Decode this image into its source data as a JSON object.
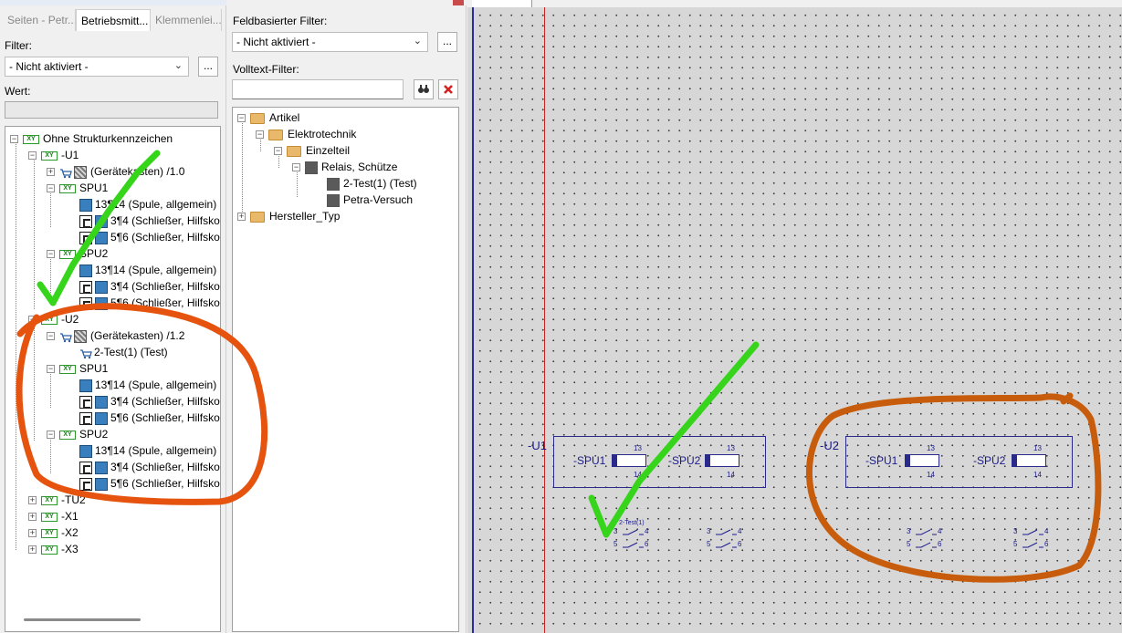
{
  "left_panel": {
    "tabs": [
      "Seiten - Petr...",
      "Betriebsmitt...",
      "Klemmenlei..."
    ],
    "filter_label": "Filter:",
    "filter_value": "- Nicht aktiviert -",
    "filter_button": "...",
    "value_label": "Wert:",
    "tree": {
      "root": "Ohne Strukturkennzeichen",
      "u1": "-U1",
      "u1_box": "(Gerätekasten) /1.0",
      "u1_spu1": "SPU1",
      "u1_spu1_coil": "13¶14 (Spule, allgemein)",
      "u1_spu1_c34": "3¶4 (Schließer, Hilfsko",
      "u1_spu1_c56": "5¶6 (Schließer, Hilfsko",
      "u1_spu2": "SPU2",
      "u1_spu2_coil": "13¶14 (Spule, allgemein)",
      "u1_spu2_c34": "3¶4 (Schließer, Hilfsko",
      "u1_spu2_c56": "5¶6 (Schließer, Hilfsko",
      "u2": "-U2",
      "u2_box": "(Gerätekasten) /1.2",
      "u2_part": "2-Test(1) (Test)",
      "u2_spu1": "SPU1",
      "u2_spu1_coil": "13¶14 (Spule, allgemein)",
      "u2_spu1_c34": "3¶4 (Schließer, Hilfsko",
      "u2_spu1_c56": "5¶6 (Schließer, Hilfsko",
      "u2_spu2": "SPU2",
      "u2_spu2_coil": "13¶14 (Spule, allgemein)",
      "u2_spu2_c34": "3¶4 (Schließer, Hilfsko",
      "u2_spu2_c56": "5¶6 (Schließer, Hilfsko",
      "tu2": "-TU2",
      "x1": "-X1",
      "x2": "-X2",
      "x3": "-X3",
      "xy_tag": "XY"
    }
  },
  "middle_panel": {
    "field_filter_label": "Feldbasierter Filter:",
    "field_filter_value": "- Nicht aktiviert -",
    "field_filter_button": "...",
    "fulltext_label": "Volltext-Filter:",
    "tree": {
      "artikel": "Artikel",
      "elektrotechnik": "Elektrotechnik",
      "einzelteil": "Einzelteil",
      "relais": "Relais, Schütze",
      "item1": "2-Test(1) (Test)",
      "item2": "Petra-Versuch",
      "hersteller": "Hersteller_Typ"
    }
  },
  "canvas": {
    "u1_label": "-U1",
    "u2_label": "-U2",
    "spu1": "-SPU1",
    "spu2": "-SPU2",
    "t13": "13",
    "t14": "14",
    "c3": "3",
    "c4": "4",
    "c5": "5",
    "c6": "6",
    "part_ref": "2-Test(1)"
  },
  "colors": {
    "annotation_green": "#37d41c",
    "annotation_orange": "#e5530f",
    "annotation_brown": "#c75d0c",
    "schematic_blue": "#1a1a8c"
  }
}
